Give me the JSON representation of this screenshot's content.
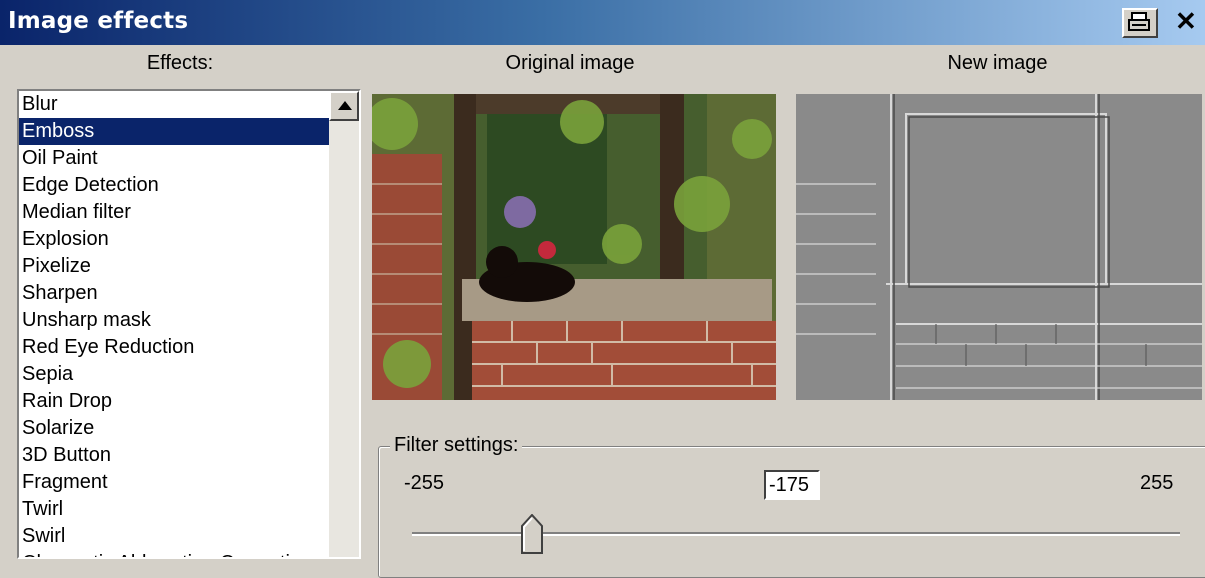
{
  "window": {
    "title": "Image effects"
  },
  "headers": {
    "effects": "Effects:",
    "original": "Original image",
    "new": "New image"
  },
  "effects": {
    "selected_index": 1,
    "items": [
      "Blur",
      "Emboss",
      "Oil Paint",
      "Edge Detection",
      "Median filter",
      "Explosion",
      "Pixelize",
      "Sharpen",
      "Unsharp mask",
      "Red Eye Reduction",
      "Sepia",
      "Rain Drop",
      "Solarize",
      "3D Button",
      "Fragment",
      "Twirl",
      "Swirl",
      "Chromatic Abberation Correction"
    ]
  },
  "filter": {
    "label": "Filter settings:",
    "min": "-255",
    "max": "255",
    "value": "-175",
    "slider_value": -175,
    "slider_min": -255,
    "slider_max": 255
  },
  "icons": {
    "print": "print-icon",
    "close": "close-icon",
    "scroll_up": "scroll-up-arrow-icon"
  }
}
